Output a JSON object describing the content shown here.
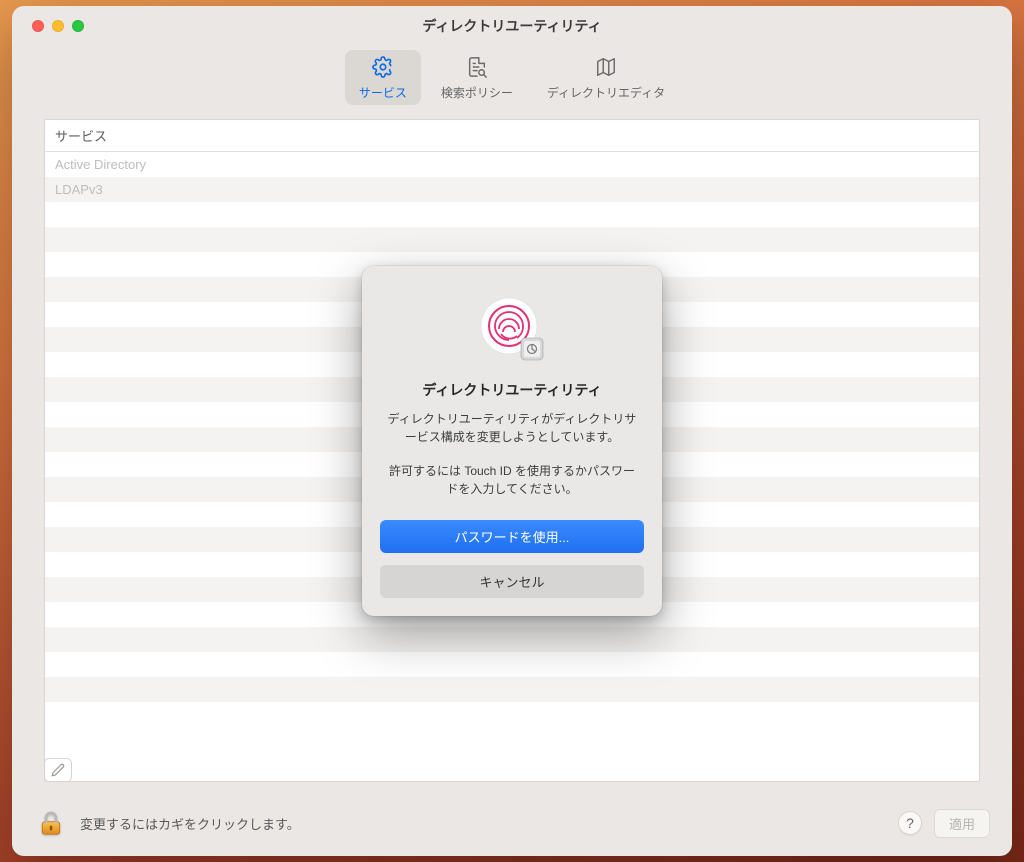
{
  "window": {
    "title": "ディレクトリユーティリティ"
  },
  "toolbar": {
    "services": "サービス",
    "search_policy": "検索ポリシー",
    "directory_editor": "ディレクトリエディタ"
  },
  "table": {
    "header": "サービス",
    "items": [
      "Active Directory",
      "LDAPv3"
    ]
  },
  "footer": {
    "lock_hint": "変更するにはカギをクリックします。",
    "help_label": "?",
    "apply_label": "適用"
  },
  "dialog": {
    "title": "ディレクトリユーティリティ",
    "message": "ディレクトリユーティリティがディレクトリサービス構成を変更しようとしています。",
    "hint": "許可するには Touch ID を使用するかパスワードを入力してください。",
    "primary_label": "パスワードを使用...",
    "cancel_label": "キャンセル"
  }
}
